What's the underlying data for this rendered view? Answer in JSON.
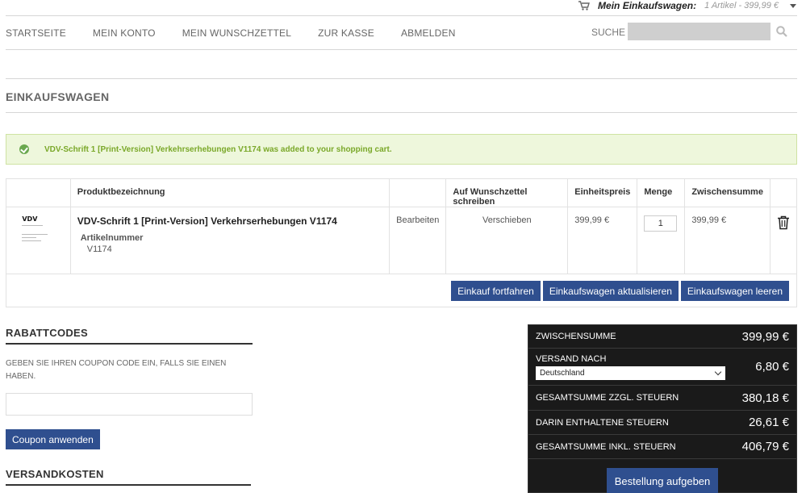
{
  "minicart": {
    "label": "Mein Einkaufswagen:",
    "summary": "1 Artikel - 399,99 €"
  },
  "nav": {
    "items": [
      "STARTSEITE",
      "MEIN KONTO",
      "MEIN WUNSCHZETTEL",
      "ZUR KASSE",
      "ABMELDEN"
    ],
    "search_label": "SUCHE",
    "search_placeholder": ""
  },
  "page": {
    "title": "EINKAUFSWAGEN"
  },
  "alert": {
    "message": "VDV-Schrift 1 [Print-Version] Verkehrserhebungen V1174 was added to your shopping cart."
  },
  "cart": {
    "columns": {
      "name": "Produktbezeichnung",
      "wishlist": "Auf Wunschzettel schreiben",
      "unit_price": "Einheitspreis",
      "qty": "Menge",
      "subtotal": "Zwischensumme"
    },
    "item": {
      "thumb_logo": "VDV",
      "name": "VDV-Schrift 1 [Print-Version] Verkehrserhebungen V1174",
      "sku_label": "Artikelnummer",
      "sku": "V1174",
      "edit": "Bearbeiten",
      "move": "Verschieben",
      "unit_price": "399,99 €",
      "qty": "1",
      "subtotal": "399,99 €"
    },
    "actions": {
      "continue": "Einkauf fortfahren",
      "update": "Einkaufswagen aktualisieren",
      "clear": "Einkaufswagen leeren"
    }
  },
  "coupon": {
    "title": "RABATTCODES",
    "description": "GEBEN SIE IHREN COUPON CODE EIN, FALLS SIE EINEN HABEN.",
    "input_value": "",
    "button": "Coupon anwenden"
  },
  "shipping": {
    "title": "VERSANDKOSTEN"
  },
  "totals": {
    "subtotal_label": "ZWISCHENSUMME",
    "subtotal": "399,99 €",
    "shipping_label": "VERSAND NACH",
    "shipping_country": "Deutschland",
    "shipping": "6,80 €",
    "grand_excl_label": "GESAMTSUMME ZZGL. STEUERN",
    "grand_excl": "380,18 €",
    "tax_label": "DARIN ENTHALTENE STEUERN",
    "tax": "26,61 €",
    "grand_incl_label": "GESAMTSUMME INKL. STEUERN",
    "grand_incl": "406,79 €",
    "checkout": "Bestellung aufgeben"
  },
  "colors": {
    "primary_button": "#2f4f8f",
    "success_bg": "#eef7dc",
    "success_text": "#7aa829",
    "totals_bg": "#1a1a1a"
  }
}
